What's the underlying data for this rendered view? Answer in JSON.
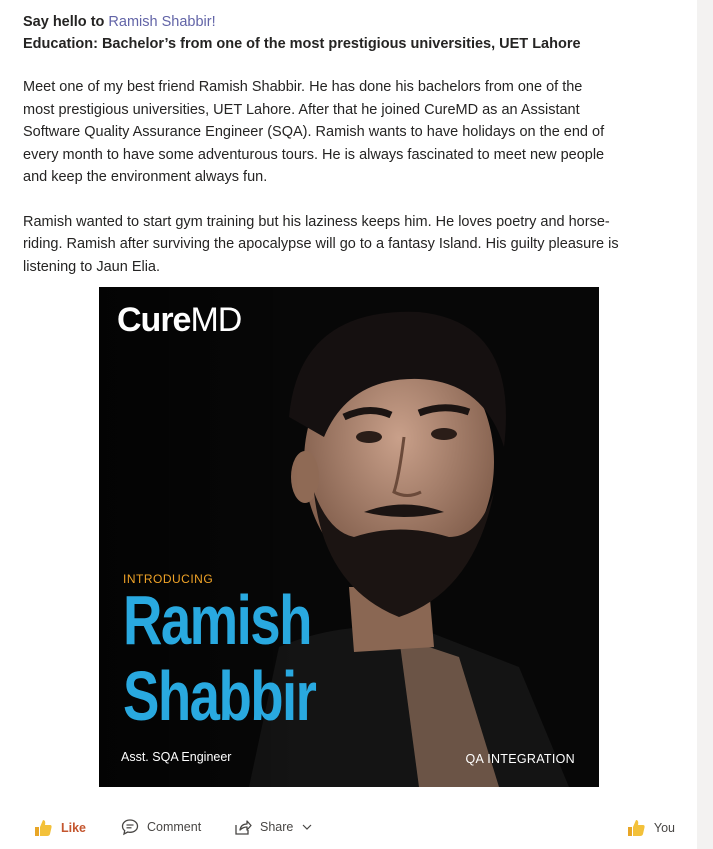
{
  "post": {
    "greeting_prefix": "Say hello to ",
    "mention_name": "Ramish Shabbir",
    "greeting_suffix": "!",
    "education": "Education: Bachelor’s from one of the most prestigious universities, UET Lahore",
    "paragraph1_lines": [
      "Meet one of my best friend Ramish Shabbir. He has done his bachelors from one of the",
      "most prestigious universities, UET Lahore. After that he joined CureMD as an Assistant",
      "Software Quality Assurance Engineer (SQA). Ramish wants to have holidays on the end of",
      "every month to have some adventurous tours. He is always fascinated to meet new people",
      "and keep the environment always fun."
    ],
    "paragraph2_lines": [
      "Ramish wanted to start gym training but his laziness keeps him. He loves poetry and horse-",
      "riding. Ramish after surviving the apocalypse will go to a fantasy Island. His guilty pleasure is",
      "listening to Jaun Elia."
    ]
  },
  "image": {
    "logo_bold": "Cure",
    "logo_light": "MD",
    "introducing": "INTRODUCING",
    "name_line1": "Ramish",
    "name_line2": "Shabbir",
    "role": "Asst. SQA Engineer",
    "team": "QA INTEGRATION",
    "accent_blue": "#29a9e0",
    "accent_orange": "#f0a327"
  },
  "actions": {
    "like_label": "Like",
    "comment_label": "Comment",
    "share_label": "Share",
    "you_label": "You"
  },
  "icons": [
    "thumbs-up-icon",
    "comment-icon",
    "share-icon",
    "chevron-down-icon"
  ]
}
